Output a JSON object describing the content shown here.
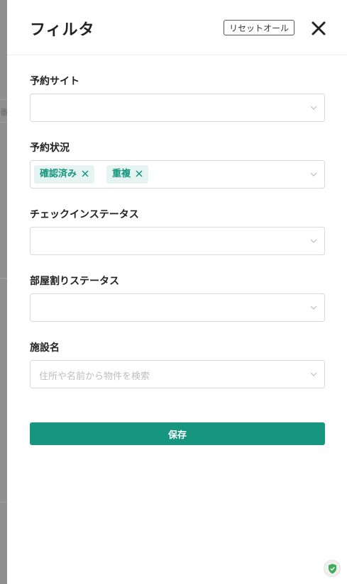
{
  "header": {
    "title": "フィルタ",
    "reset_label": "リセットオール"
  },
  "background": {
    "partial_text": "番"
  },
  "fields": {
    "reservation_site": {
      "label": "予約サイト",
      "value": ""
    },
    "reservation_status": {
      "label": "予約状況",
      "tags": [
        "確認済み",
        "重複"
      ]
    },
    "checkin_status": {
      "label": "チェックインステータス",
      "value": ""
    },
    "room_assignment_status": {
      "label": "部屋割りステータス",
      "value": ""
    },
    "facility_name": {
      "label": "施設名",
      "placeholder": "住所や名前から物件を検索"
    }
  },
  "footer": {
    "save_label": "保存"
  },
  "colors": {
    "accent": "#16967f",
    "tag_background": "#e6f4f1",
    "border": "#d9d9d9"
  },
  "icons": {
    "close": "close-icon",
    "chevron": "chevron-down-icon",
    "tag_remove": "close-icon",
    "badge": "shield-check-icon"
  }
}
